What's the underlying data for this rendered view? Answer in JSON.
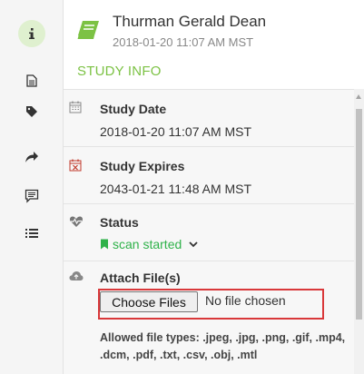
{
  "rail": {
    "items": [
      {
        "icon": "info-icon",
        "active": true
      },
      {
        "icon": "document-icon",
        "active": false
      },
      {
        "icon": "tag-icon",
        "active": false
      },
      {
        "icon": "share-icon",
        "active": false
      },
      {
        "icon": "comment-icon",
        "active": false
      },
      {
        "icon": "list-icon",
        "active": false
      }
    ]
  },
  "header": {
    "patient_name": "Thurman Gerald Dean",
    "study_datetime": "2018-01-20 11:07 AM MST",
    "section_title": "STUDY INFO"
  },
  "study_info": {
    "study_date_label": "Study Date",
    "study_date_value": "2018-01-20 11:07 AM MST",
    "study_expires_label": "Study Expires",
    "study_expires_value": "2043-01-21 11:48 AM MST",
    "status_label": "Status",
    "status_value": "scan started",
    "attach_label": "Attach File(s)",
    "choose_button": "Choose Files",
    "no_file_text": "No file chosen",
    "allowed_types": "Allowed file types: .jpeg, .jpg, .png, .gif, .mp4, .dcm, .pdf, .txt, .csv, .obj, .mtl"
  },
  "colors": {
    "accent_green": "#7cc244",
    "status_green": "#2fb24a",
    "highlight_red": "#d9383a"
  }
}
